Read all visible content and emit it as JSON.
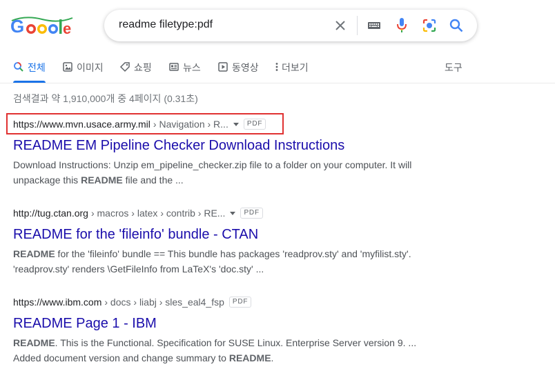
{
  "search": {
    "query": "readme filetype:pdf"
  },
  "logo": {
    "alt": "Google"
  },
  "tabs": [
    {
      "label": "전체",
      "icon": "search-icon",
      "active": true
    },
    {
      "label": "이미지",
      "icon": "image-icon"
    },
    {
      "label": "쇼핑",
      "icon": "tag-icon"
    },
    {
      "label": "뉴스",
      "icon": "news-icon"
    },
    {
      "label": "동영상",
      "icon": "play-icon"
    },
    {
      "label": "더보기",
      "icon": "more-vert-icon"
    }
  ],
  "tools_label": "도구",
  "stats": "검색결과 약 1,910,000개 중 4페이지 (0.31초)",
  "results": [
    {
      "domain": "https://www.mvn.usace.army.mil",
      "path": "› Navigation › R...",
      "badge": "PDF",
      "title": "README EM Pipeline Checker Download Instructions",
      "snippet_parts": [
        {
          "t": "Download Instructions: Unzip em_pipeline_checker.zip file to a folder on your computer. It will unpackage this ",
          "b": false
        },
        {
          "t": "README",
          "b": true
        },
        {
          "t": " file and the ...",
          "b": false
        }
      ]
    },
    {
      "domain": "http://tug.ctan.org",
      "path": "› macros › latex › contrib › RE...",
      "badge": "PDF",
      "title": "README for the 'fileinfo' bundle - CTAN",
      "snippet_parts": [
        {
          "t": "README",
          "b": true
        },
        {
          "t": " for the 'fileinfo' bundle == This bundle has packages 'readprov.sty' and 'myfilist.sty'. 'readprov.sty' renders \\GetFileInfo from LaTeX's 'doc.sty' ...",
          "b": false
        }
      ]
    },
    {
      "domain": "https://www.ibm.com",
      "path": "› docs › liabj › sles_eal4_fsp",
      "badge": "PDF",
      "title": "README Page 1 - IBM",
      "snippet_parts": [
        {
          "t": "README",
          "b": true
        },
        {
          "t": ". This is the Functional. Specification for SUSE Linux. Enterprise Server version 9. ... Added document version and change summary to ",
          "b": false
        },
        {
          "t": "README",
          "b": true
        },
        {
          "t": ".",
          "b": false
        }
      ]
    }
  ],
  "colors": {
    "link": "#1a0dab",
    "accent": "#1a73e8",
    "highlight": "#e03131"
  }
}
